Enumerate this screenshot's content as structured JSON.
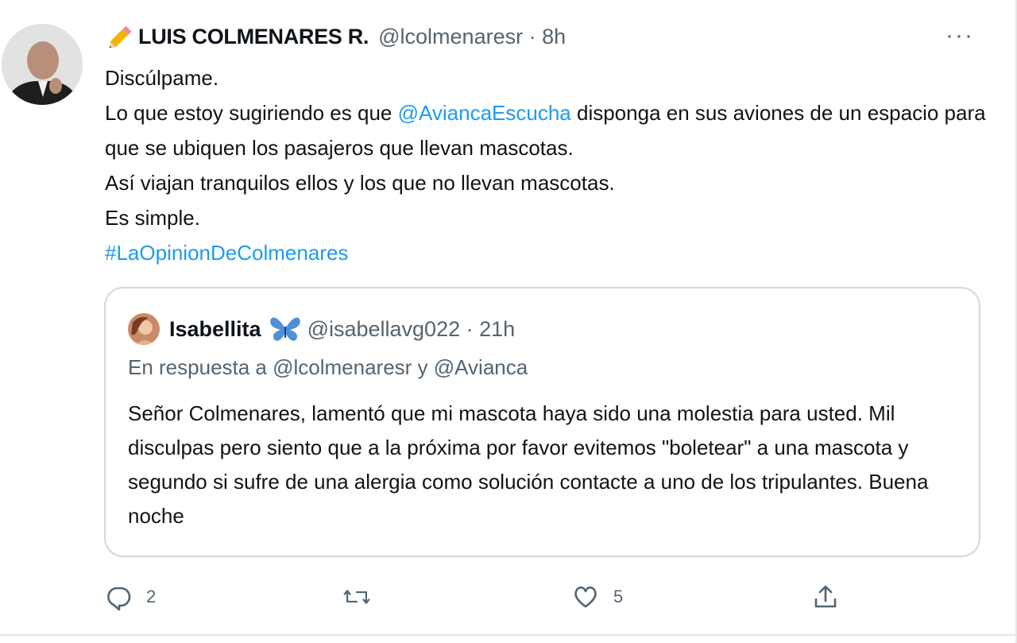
{
  "tweet": {
    "author_name": "LUIS COLMENARES R.",
    "meta": "@lcolmenaresr · 8h",
    "more": "···",
    "body": {
      "line1": "Discúlpame.",
      "line2_pre": "Lo que estoy sugiriendo es que ",
      "line2_mention": "@AviancaEscucha",
      "line2_post": " disponga en sus aviones de un espacio para que se ubiquen los pasajeros que llevan mascotas.",
      "line3": "Así viajan tranquilos ellos y los que no llevan mascotas.",
      "line4": "Es simple.",
      "hashtag": "#LaOpinionDeColmenares"
    }
  },
  "quote": {
    "author_name": "Isabellita",
    "meta": "@isabellavg022 · 21h",
    "reply_to": "En respuesta a @lcolmenaresr y @Avianca",
    "body": "Señor Colmenares, lamentó que mi mascota haya sido una molestia para usted. Mil disculpas pero siento que a la próxima por favor evitemos \"boletear\" a una mascota y segundo si sufre de una alergia como solución contacte a uno de los tripulantes. Buena noche"
  },
  "actions": {
    "reply": {
      "icon": "reply-icon",
      "count": "2"
    },
    "retweet": {
      "icon": "retweet-icon",
      "count": ""
    },
    "like": {
      "icon": "like-icon",
      "count": "5"
    },
    "share": {
      "icon": "share-icon"
    }
  },
  "colors": {
    "link": "#1d9bf0",
    "secondary_text": "#536471",
    "border": "#cfd9de"
  }
}
